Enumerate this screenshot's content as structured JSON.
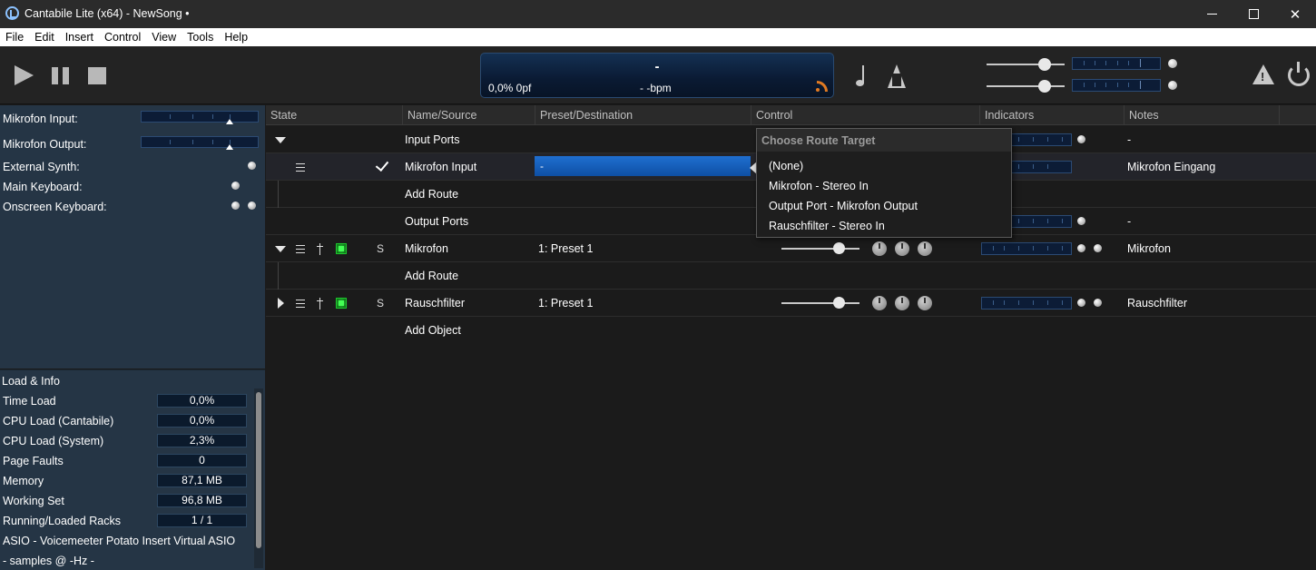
{
  "window": {
    "title": "Cantabile Lite (x64) - NewSong •"
  },
  "menu": [
    "File",
    "Edit",
    "Insert",
    "Control",
    "View",
    "Tools",
    "Help"
  ],
  "display": {
    "song": "-",
    "load": "0,0%  0pf",
    "bpm": "- -bpm"
  },
  "ports": [
    {
      "label": "Mikrofon Input:",
      "type": "meter"
    },
    {
      "label": "Mikrofon Output:",
      "type": "meter"
    },
    {
      "label": "External Synth:",
      "type": "led1"
    },
    {
      "label": "Main Keyboard:",
      "type": "led1"
    },
    {
      "label": "Onscreen Keyboard:",
      "type": "led2"
    }
  ],
  "load_info": {
    "header": "Load & Info",
    "stats": [
      {
        "label": "Time Load",
        "value": "0,0%"
      },
      {
        "label": "CPU Load (Cantabile)",
        "value": "0,0%"
      },
      {
        "label": "CPU Load (System)",
        "value": "2,3%"
      },
      {
        "label": "Page Faults",
        "value": "0"
      },
      {
        "label": "Memory",
        "value": "87,1 MB"
      },
      {
        "label": "Working Set",
        "value": "96,8 MB"
      },
      {
        "label": "Running/Loaded Racks",
        "value": "1 / 1"
      }
    ],
    "driver": "ASIO - Voicemeeter Potato Insert Virtual ASIO",
    "samples": "- samples @ -Hz -"
  },
  "columns": [
    "State",
    "Name/Source",
    "Preset/Destination",
    "Control",
    "Indicators",
    "Notes"
  ],
  "rows": {
    "input_ports": {
      "name": "Input Ports",
      "notes": "-"
    },
    "mikrofon_input": {
      "name": "Mikrofon Input",
      "destination": "-",
      "notes": "Mikrofon Eingang"
    },
    "add_route_1": {
      "name": "Add Route"
    },
    "output_ports": {
      "name": "Output Ports",
      "notes": "-"
    },
    "mikrofon": {
      "solo": "S",
      "name": "Mikrofon",
      "preset": "1: Preset 1",
      "notes": "Mikrofon"
    },
    "add_route_2": {
      "name": "Add Route"
    },
    "rauschfilter": {
      "solo": "S",
      "name": "Rauschfilter",
      "preset": "1: Preset 1",
      "notes": "Rauschfilter"
    },
    "add_object": {
      "name": "Add Object"
    }
  },
  "route_popup": {
    "header": "Choose Route Target",
    "items": [
      "(None)",
      "Mikrofon - Stereo In",
      "Output Port - Mikrofon Output",
      "Rauschfilter - Stereo In"
    ]
  },
  "icons": {
    "play": "play-icon",
    "pause": "pause-icon",
    "stop": "stop-icon",
    "note": "note-icon",
    "metronome": "metronome-icon",
    "warning": "warning-icon",
    "power": "power-icon"
  }
}
